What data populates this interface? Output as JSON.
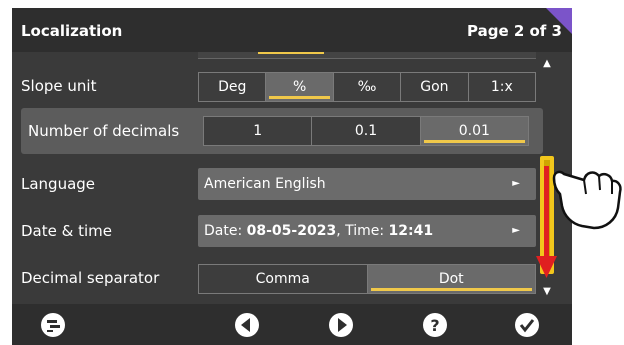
{
  "header": {
    "title": "Localization",
    "page": "Page 2 of 3"
  },
  "rows": {
    "slope_unit": {
      "label": "Slope unit",
      "options": [
        "Deg",
        "%",
        "‰",
        "Gon",
        "1:x"
      ],
      "selected": "%"
    },
    "decimals": {
      "label": "Number of decimals",
      "options": [
        "1",
        "0.1",
        "0.01"
      ],
      "selected": "0.01"
    },
    "language": {
      "label": "Language",
      "value": "American English"
    },
    "datetime": {
      "label": "Date & time",
      "date_prefix": "Date: ",
      "date": "08-05-2023",
      "time_prefix": ", Time: ",
      "time": "12:41"
    },
    "separator": {
      "label": "Decimal separator",
      "options": [
        "Comma",
        "Dot"
      ],
      "selected": "Dot"
    }
  },
  "icons": {
    "footer": [
      "menu-screen-icon",
      "previous-icon",
      "next-icon",
      "help-icon",
      "confirm-icon"
    ],
    "scroll_up": "▲",
    "scroll_down": "▼",
    "field_arrow": "►"
  },
  "colors": {
    "accent": "#f0c84a",
    "corner": "#7b54c9",
    "scrollbar": "#f2c71c",
    "annotation_arrow": "#e02020"
  }
}
